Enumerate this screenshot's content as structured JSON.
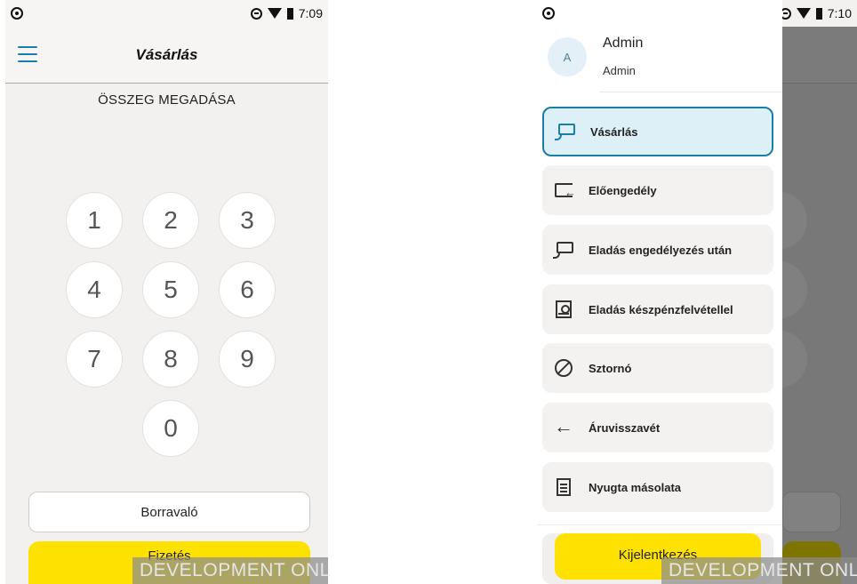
{
  "left_screen": {
    "status_bar": {
      "time": "7:09"
    },
    "app_bar": {
      "title": "Vásárlás"
    },
    "section_label": "ÖSSZEG MEGADÁSA",
    "keypad": {
      "keys": [
        "1",
        "2",
        "3",
        "4",
        "5",
        "6",
        "7",
        "8",
        "9",
        "0"
      ]
    },
    "tip_button": "Borravaló",
    "pay_button": "Fizetés",
    "watermark": "DEVELOPMENT ONLY"
  },
  "right_screen": {
    "status_bar": {
      "time": "7:10"
    },
    "profile": {
      "avatar_initial": "A",
      "name": "Admin",
      "role": "Admin"
    },
    "menu_items": [
      {
        "label": "Vásárlás",
        "icon": "contactless-card-icon",
        "active": true
      },
      {
        "label": "Előengedély",
        "icon": "preauth-icon",
        "active": false
      },
      {
        "label": "Eladás engedélyezés után",
        "icon": "contactless-card-icon",
        "active": false
      },
      {
        "label": "Eladás készpénzfelvétellel",
        "icon": "cash-safe-icon",
        "active": false
      },
      {
        "label": "Sztornó",
        "icon": "cancel-icon",
        "active": false
      },
      {
        "label": "Áruvisszavét",
        "icon": "arrow-back-icon",
        "active": false
      },
      {
        "label": "Nyugta másolata",
        "icon": "receipt-icon",
        "active": false
      }
    ],
    "logout_button": "Kijelentkezés",
    "watermark": "DEVELOPMENT ONLY"
  },
  "colors": {
    "accent": "#1a7fa8",
    "primary_button": "#ffe100",
    "background": "#f3f1ef",
    "active_item_bg": "#ddf0f8",
    "scrim": "#787878"
  }
}
